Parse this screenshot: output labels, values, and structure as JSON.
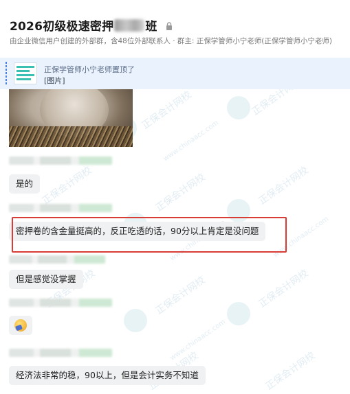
{
  "header": {
    "title_prefix": "2026初级极速密押",
    "title_suffix": "班",
    "subtitle": "由企业微信用户创建的外部群，含48位外部联系人 · 群主: 正保学管师小宁老师(正保学管师小宁老师)"
  },
  "pinned": {
    "line1": "正保学管师小宁老师置顶了",
    "line2": "[图片]"
  },
  "messages": [
    {
      "text": "是的"
    },
    {
      "text": "密押卷的含金量挺高的，反正吃透的话，90分以上肯定是没问题"
    },
    {
      "text": "但是感觉没掌握"
    },
    {
      "text": "经济法非常的稳，90以上，但是会计实务不知道"
    }
  ],
  "watermark": {
    "text": "正保会计网校",
    "url": "www.chinaacc.com"
  },
  "colors": {
    "highlight": "#d93b35",
    "pinned_bg": "#eaf2fd",
    "bubble_bg": "#f0f1f3"
  }
}
